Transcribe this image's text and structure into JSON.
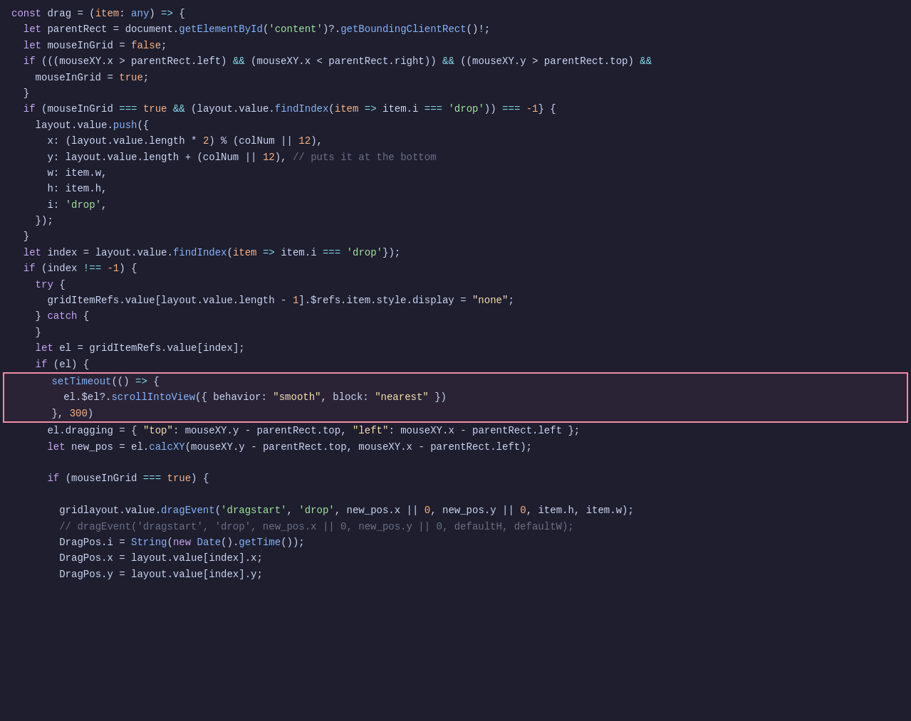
{
  "editor": {
    "background": "#1e1e2e",
    "lines": [
      {
        "indent": 0,
        "tokens": [
          {
            "t": "kw",
            "v": "const "
          },
          {
            "t": "white",
            "v": "drag "
          },
          {
            "t": "white",
            "v": "= "
          },
          {
            "t": "white",
            "v": "("
          },
          {
            "t": "param",
            "v": "item"
          },
          {
            "t": "white",
            "v": ": "
          },
          {
            "t": "blue",
            "v": "any"
          },
          {
            "t": "white",
            "v": ") "
          },
          {
            "t": "cyan",
            "v": "=>"
          },
          {
            "t": "white",
            "v": " {"
          }
        ]
      },
      {
        "indent": 1,
        "tokens": [
          {
            "t": "kw",
            "v": "let "
          },
          {
            "t": "white",
            "v": "parentRect "
          },
          {
            "t": "white",
            "v": "= "
          },
          {
            "t": "white",
            "v": "document."
          },
          {
            "t": "blue",
            "v": "getElementById"
          },
          {
            "t": "white",
            "v": "("
          },
          {
            "t": "green",
            "v": "'content'"
          },
          {
            "t": "white",
            "v": ")?"
          },
          {
            "t": "white",
            "v": "."
          },
          {
            "t": "blue",
            "v": "getBoundingClientRect"
          },
          {
            "t": "white",
            "v": "()!;"
          }
        ]
      },
      {
        "indent": 1,
        "tokens": [
          {
            "t": "kw",
            "v": "let "
          },
          {
            "t": "white",
            "v": "mouseInGrid "
          },
          {
            "t": "white",
            "v": "= "
          },
          {
            "t": "orange",
            "v": "false"
          },
          {
            "t": "white",
            "v": ";"
          }
        ]
      },
      {
        "indent": 1,
        "tokens": [
          {
            "t": "kw",
            "v": "if "
          },
          {
            "t": "white",
            "v": "(((mouseXY.x "
          },
          {
            "t": "white",
            "v": "> "
          },
          {
            "t": "white",
            "v": "parentRect.left) "
          },
          {
            "t": "cyan",
            "v": "&&"
          },
          {
            "t": "white",
            "v": " (mouseXY.x "
          },
          {
            "t": "white",
            "v": "< "
          },
          {
            "t": "white",
            "v": "parentRect.right)) "
          },
          {
            "t": "cyan",
            "v": "&&"
          },
          {
            "t": "white",
            "v": " ((mouseXY.y "
          },
          {
            "t": "white",
            "v": "> "
          },
          {
            "t": "white",
            "v": "parentRect.top) "
          },
          {
            "t": "cyan",
            "v": "&&"
          }
        ]
      },
      {
        "indent": 2,
        "tokens": [
          {
            "t": "white",
            "v": "mouseInGrid "
          },
          {
            "t": "white",
            "v": "= "
          },
          {
            "t": "orange",
            "v": "true"
          },
          {
            "t": "white",
            "v": ";"
          }
        ]
      },
      {
        "indent": 1,
        "tokens": [
          {
            "t": "white",
            "v": "}"
          }
        ]
      },
      {
        "indent": 1,
        "tokens": [
          {
            "t": "kw",
            "v": "if "
          },
          {
            "t": "white",
            "v": "(mouseInGrid "
          },
          {
            "t": "cyan",
            "v": "==="
          },
          {
            "t": "white",
            "v": " "
          },
          {
            "t": "orange",
            "v": "true"
          },
          {
            "t": "white",
            "v": " "
          },
          {
            "t": "cyan",
            "v": "&&"
          },
          {
            "t": "white",
            "v": " (layout.value."
          },
          {
            "t": "blue",
            "v": "findIndex"
          },
          {
            "t": "white",
            "v": "("
          },
          {
            "t": "param",
            "v": "item"
          },
          {
            "t": "white",
            "v": " "
          },
          {
            "t": "cyan",
            "v": "=>"
          },
          {
            "t": "white",
            "v": " item.i "
          },
          {
            "t": "cyan",
            "v": "==="
          },
          {
            "t": "white",
            "v": " "
          },
          {
            "t": "green",
            "v": "'drop'"
          },
          {
            "t": "white",
            "v": ")) "
          },
          {
            "t": "cyan",
            "v": "==="
          },
          {
            "t": "white",
            "v": " "
          },
          {
            "t": "orange",
            "v": "-1"
          },
          {
            "t": "white",
            "v": "} {"
          }
        ]
      },
      {
        "indent": 2,
        "tokens": [
          {
            "t": "white",
            "v": "layout.value."
          },
          {
            "t": "blue",
            "v": "push"
          },
          {
            "t": "white",
            "v": "({"
          }
        ]
      },
      {
        "indent": 3,
        "tokens": [
          {
            "t": "white",
            "v": "x: (layout.value.length "
          },
          {
            "t": "white",
            "v": "* "
          },
          {
            "t": "orange",
            "v": "2"
          },
          {
            "t": "white",
            "v": ") % (colNum "
          },
          {
            "t": "white",
            "v": "|| "
          },
          {
            "t": "orange",
            "v": "12"
          },
          {
            "t": "white",
            "v": "),"
          }
        ]
      },
      {
        "indent": 3,
        "tokens": [
          {
            "t": "white",
            "v": "y: layout.value.length + (colNum "
          },
          {
            "t": "white",
            "v": "|| "
          },
          {
            "t": "orange",
            "v": "12"
          },
          {
            "t": "white",
            "v": ")"
          },
          {
            "t": "white",
            "v": ", "
          },
          {
            "t": "gray",
            "v": "// puts it at the bottom"
          }
        ]
      },
      {
        "indent": 3,
        "tokens": [
          {
            "t": "white",
            "v": "w: item.w,"
          }
        ]
      },
      {
        "indent": 3,
        "tokens": [
          {
            "t": "white",
            "v": "h: item.h,"
          }
        ]
      },
      {
        "indent": 3,
        "tokens": [
          {
            "t": "white",
            "v": "i: "
          },
          {
            "t": "green",
            "v": "'drop'"
          },
          {
            "t": "white",
            "v": ","
          }
        ]
      },
      {
        "indent": 2,
        "tokens": [
          {
            "t": "white",
            "v": "});"
          }
        ]
      },
      {
        "indent": 1,
        "tokens": [
          {
            "t": "white",
            "v": "}"
          }
        ]
      },
      {
        "indent": 1,
        "tokens": [
          {
            "t": "kw",
            "v": "let "
          },
          {
            "t": "white",
            "v": "index "
          },
          {
            "t": "white",
            "v": "= "
          },
          {
            "t": "white",
            "v": "layout.value."
          },
          {
            "t": "blue",
            "v": "findIndex"
          },
          {
            "t": "white",
            "v": "("
          },
          {
            "t": "param",
            "v": "item"
          },
          {
            "t": "white",
            "v": " "
          },
          {
            "t": "cyan",
            "v": "=>"
          },
          {
            "t": "white",
            "v": " item.i "
          },
          {
            "t": "cyan",
            "v": "==="
          },
          {
            "t": "white",
            "v": " "
          },
          {
            "t": "green",
            "v": "'drop'"
          },
          {
            "t": "white",
            "v": "});"
          }
        ]
      },
      {
        "indent": 1,
        "tokens": [
          {
            "t": "kw",
            "v": "if "
          },
          {
            "t": "white",
            "v": "(index "
          },
          {
            "t": "cyan",
            "v": "!=="
          },
          {
            "t": "white",
            "v": " "
          },
          {
            "t": "orange",
            "v": "-1"
          },
          {
            "t": "white",
            "v": ") {"
          }
        ]
      },
      {
        "indent": 2,
        "tokens": [
          {
            "t": "kw",
            "v": "try "
          },
          {
            "t": "white",
            "v": "{"
          }
        ]
      },
      {
        "indent": 3,
        "tokens": [
          {
            "t": "white",
            "v": "gridItemRefs.value[layout.value.length "
          },
          {
            "t": "white",
            "v": "- "
          },
          {
            "t": "orange",
            "v": "1"
          },
          {
            "t": "white",
            "v": "].$refs.item.style.display "
          },
          {
            "t": "white",
            "v": "= "
          },
          {
            "t": "yellow",
            "v": "\"none\""
          },
          {
            "t": "white",
            "v": ";"
          }
        ]
      },
      {
        "indent": 2,
        "tokens": [
          {
            "t": "white",
            "v": "} "
          },
          {
            "t": "kw",
            "v": "catch"
          },
          {
            "t": "white",
            "v": " {"
          }
        ]
      },
      {
        "indent": 2,
        "tokens": [
          {
            "t": "white",
            "v": "}"
          }
        ]
      },
      {
        "indent": 2,
        "tokens": [
          {
            "t": "kw",
            "v": "let "
          },
          {
            "t": "white",
            "v": "el "
          },
          {
            "t": "white",
            "v": "= "
          },
          {
            "t": "white",
            "v": "gridItemRefs.value[index];"
          }
        ]
      },
      {
        "indent": 2,
        "tokens": [
          {
            "t": "kw",
            "v": "if "
          },
          {
            "t": "white",
            "v": "(el) {"
          }
        ]
      },
      {
        "indent": 3,
        "highlight": true,
        "tokens": [
          {
            "t": "blue",
            "v": "setTimeout"
          },
          {
            "t": "white",
            "v": "(() "
          },
          {
            "t": "cyan",
            "v": "=>"
          },
          {
            "t": "white",
            "v": " {"
          }
        ]
      },
      {
        "indent": 4,
        "highlight": true,
        "tokens": [
          {
            "t": "white",
            "v": "el.$el?."
          },
          {
            "t": "blue",
            "v": "scrollIntoView"
          },
          {
            "t": "white",
            "v": "({ behavior: "
          },
          {
            "t": "yellow",
            "v": "\"smooth\""
          },
          {
            "t": "white",
            "v": ", block: "
          },
          {
            "t": "yellow",
            "v": "\"nearest\""
          },
          {
            "t": "white",
            "v": " })"
          }
        ]
      },
      {
        "indent": 3,
        "highlight": true,
        "tokens": [
          {
            "t": "white",
            "v": "}, "
          },
          {
            "t": "orange",
            "v": "300"
          },
          {
            "t": "white",
            "v": ")"
          }
        ]
      },
      {
        "indent": 3,
        "tokens": [
          {
            "t": "white",
            "v": "el.dragging "
          },
          {
            "t": "white",
            "v": "= "
          },
          {
            "t": "white",
            "v": "{ "
          },
          {
            "t": "yellow",
            "v": "\"top\""
          },
          {
            "t": "white",
            "v": ": mouseXY.y "
          },
          {
            "t": "white",
            "v": "- "
          },
          {
            "t": "white",
            "v": "parentRect.top, "
          },
          {
            "t": "yellow",
            "v": "\"left\""
          },
          {
            "t": "white",
            "v": ": mouseXY.x "
          },
          {
            "t": "white",
            "v": "- "
          },
          {
            "t": "white",
            "v": "parentRect.left };"
          }
        ]
      },
      {
        "indent": 3,
        "tokens": [
          {
            "t": "kw",
            "v": "let "
          },
          {
            "t": "white",
            "v": "new_pos "
          },
          {
            "t": "white",
            "v": "= "
          },
          {
            "t": "white",
            "v": "el."
          },
          {
            "t": "blue",
            "v": "calcXY"
          },
          {
            "t": "white",
            "v": "(mouseXY.y "
          },
          {
            "t": "white",
            "v": "- "
          },
          {
            "t": "white",
            "v": "parentRect.top, mouseXY.x "
          },
          {
            "t": "white",
            "v": "- "
          },
          {
            "t": "white",
            "v": "parentRect.left);"
          }
        ]
      },
      {
        "indent": 0,
        "tokens": []
      },
      {
        "indent": 3,
        "tokens": [
          {
            "t": "kw",
            "v": "if "
          },
          {
            "t": "white",
            "v": "(mouseInGrid "
          },
          {
            "t": "cyan",
            "v": "==="
          },
          {
            "t": "white",
            "v": " "
          },
          {
            "t": "orange",
            "v": "true"
          },
          {
            "t": "white",
            "v": ") {"
          }
        ]
      },
      {
        "indent": 0,
        "tokens": []
      },
      {
        "indent": 4,
        "tokens": [
          {
            "t": "white",
            "v": "gridlayout.value."
          },
          {
            "t": "blue",
            "v": "dragEvent"
          },
          {
            "t": "white",
            "v": "("
          },
          {
            "t": "green",
            "v": "'dragstart'"
          },
          {
            "t": "white",
            "v": ", "
          },
          {
            "t": "green",
            "v": "'drop'"
          },
          {
            "t": "white",
            "v": ", new_pos.x "
          },
          {
            "t": "white",
            "v": "|| "
          },
          {
            "t": "orange",
            "v": "0"
          },
          {
            "t": "white",
            "v": ", new_pos.y "
          },
          {
            "t": "white",
            "v": "|| "
          },
          {
            "t": "orange",
            "v": "0"
          },
          {
            "t": "white",
            "v": ", item.h, item.w);"
          }
        ]
      },
      {
        "indent": 4,
        "tokens": [
          {
            "t": "gray",
            "v": "// dragEvent('dragstart', 'drop', new_pos.x || 0, new_pos.y || 0, defaultH, defaultW);"
          }
        ]
      },
      {
        "indent": 4,
        "tokens": [
          {
            "t": "white",
            "v": "DragPos.i "
          },
          {
            "t": "white",
            "v": "= "
          },
          {
            "t": "blue",
            "v": "String"
          },
          {
            "t": "white",
            "v": "("
          },
          {
            "t": "kw",
            "v": "new "
          },
          {
            "t": "blue",
            "v": "Date"
          },
          {
            "t": "white",
            "v": "()."
          },
          {
            "t": "blue",
            "v": "getTime"
          },
          {
            "t": "white",
            "v": "());"
          }
        ]
      },
      {
        "indent": 4,
        "tokens": [
          {
            "t": "white",
            "v": "DragPos.x "
          },
          {
            "t": "white",
            "v": "= "
          },
          {
            "t": "white",
            "v": "layout.value[index].x;"
          }
        ]
      },
      {
        "indent": 4,
        "tokens": [
          {
            "t": "white",
            "v": "DragPos.y "
          },
          {
            "t": "white",
            "v": "= "
          },
          {
            "t": "white",
            "v": "layout.value[index].y;"
          }
        ]
      }
    ]
  }
}
